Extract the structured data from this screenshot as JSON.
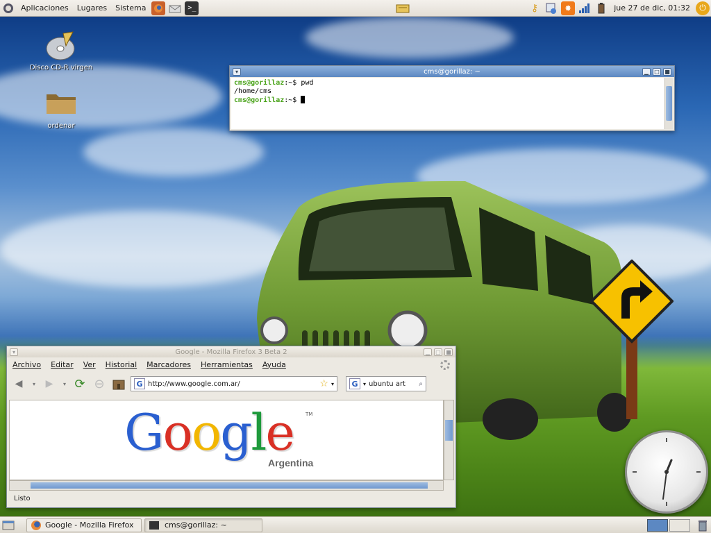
{
  "top_panel": {
    "menus": {
      "applications": "Aplicaciones",
      "places": "Lugares",
      "system": "Sistema"
    },
    "clock": "jue 27 de dic, 01:32"
  },
  "desktop_icons": [
    {
      "label": "Disco CD-R virgen"
    },
    {
      "label": "ordenar"
    }
  ],
  "terminal": {
    "title": "cms@gorillaz: ~",
    "lines": [
      {
        "prompt": "cms@gorillaz",
        "path": ":~$ ",
        "command": "pwd"
      },
      {
        "output": "/home/cms"
      },
      {
        "prompt": "cms@gorillaz",
        "path": ":~$ ",
        "command": ""
      }
    ]
  },
  "firefox": {
    "title": "Google - Mozilla Firefox 3 Beta 2",
    "menu": [
      "Archivo",
      "Editar",
      "Ver",
      "Historial",
      "Marcadores",
      "Herramientas",
      "Ayuda"
    ],
    "url": "http://www.google.com.ar/",
    "search_value": "ubuntu art",
    "status": "Listo",
    "logo_letters": [
      "G",
      "o",
      "o",
      "g",
      "l",
      "e"
    ],
    "logo_country": "Argentina",
    "logo_tm": "TM"
  },
  "taskbar": {
    "items": [
      {
        "label": "Google - Mozilla Firefox",
        "active": false
      },
      {
        "label": "cms@gorillaz: ~",
        "active": true
      }
    ]
  },
  "colors": {
    "accent": "#5c88c2",
    "prompt_green": "#4aa31a",
    "google_blue": "#2a5fd0",
    "google_red": "#d93025",
    "google_yellow": "#f2b600",
    "google_green": "#1f9a3c"
  }
}
